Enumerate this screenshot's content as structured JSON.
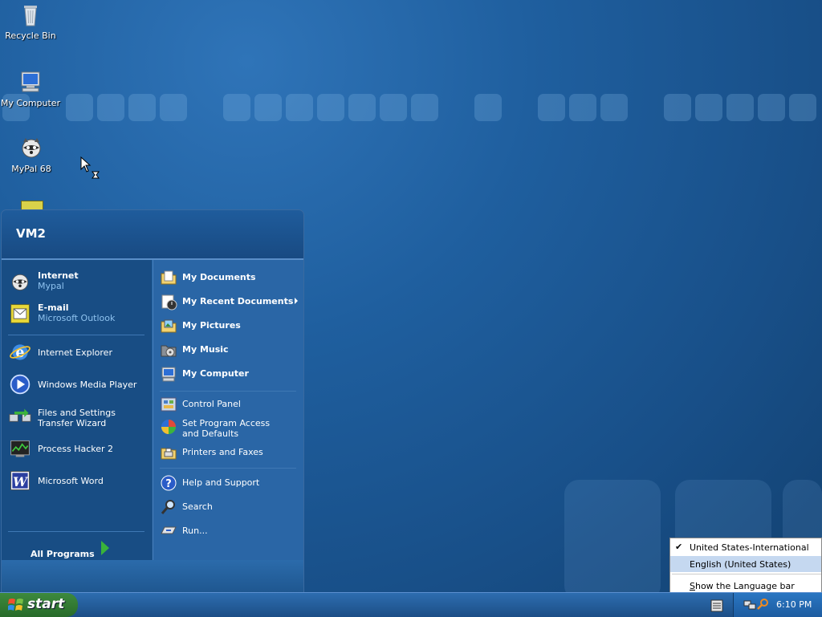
{
  "desktop": {
    "icons": [
      {
        "label": "Recycle Bin",
        "icon": "recycle-bin-icon"
      },
      {
        "label": "My Computer",
        "icon": "computer-icon"
      },
      {
        "label": "MyPal 68",
        "icon": "mypal-raccoon-icon"
      }
    ]
  },
  "start_menu": {
    "user": "VM2",
    "left_items": [
      {
        "title": "Internet",
        "subtitle": "Mypal",
        "icon": "mypal-raccoon-icon"
      },
      {
        "title": "E-mail",
        "subtitle": "Microsoft Outlook",
        "icon": "outlook-icon"
      },
      {
        "title": "Internet Explorer",
        "icon": "internet-explorer-icon"
      },
      {
        "title": "Windows Media Player",
        "icon": "media-player-icon"
      },
      {
        "title": "Files and Settings Transfer Wizard",
        "icon": "transfer-wizard-icon"
      },
      {
        "title": "Process Hacker 2",
        "icon": "process-hacker-icon"
      },
      {
        "title": "Microsoft Word",
        "icon": "word-icon"
      }
    ],
    "all_programs": "All Programs",
    "right_items": [
      {
        "label": "My Documents",
        "icon": "folder-icon"
      },
      {
        "label": "My Recent Documents",
        "icon": "recent-documents-icon"
      },
      {
        "label": "My Pictures",
        "icon": "pictures-folder-icon"
      },
      {
        "label": "My Music",
        "icon": "music-folder-icon"
      },
      {
        "label": "My Computer",
        "icon": "computer-icon"
      },
      {
        "label": "Control Panel",
        "icon": "control-panel-icon"
      },
      {
        "label": "Set Program Access and Defaults",
        "icon": "program-defaults-icon"
      },
      {
        "label": "Printers and Faxes",
        "icon": "printer-icon"
      },
      {
        "label": "Help and Support",
        "icon": "help-icon"
      },
      {
        "label": "Search",
        "icon": "search-icon"
      },
      {
        "label": "Run...",
        "icon": "run-icon"
      }
    ]
  },
  "taskbar": {
    "start_label": "start",
    "clock": "6:10 PM"
  },
  "language_menu": {
    "items": [
      {
        "label": "United States-International",
        "checked": true
      },
      {
        "label": "English (United States)",
        "checked": false
      },
      {
        "label": "Show the Language bar",
        "checked": false
      }
    ]
  },
  "colors": {
    "desktop_blue": "#1f5f9f",
    "taskbar_blue": "#245c9a",
    "start_green": "#3d8a3d",
    "menu_selection": "#c5d8f0"
  }
}
